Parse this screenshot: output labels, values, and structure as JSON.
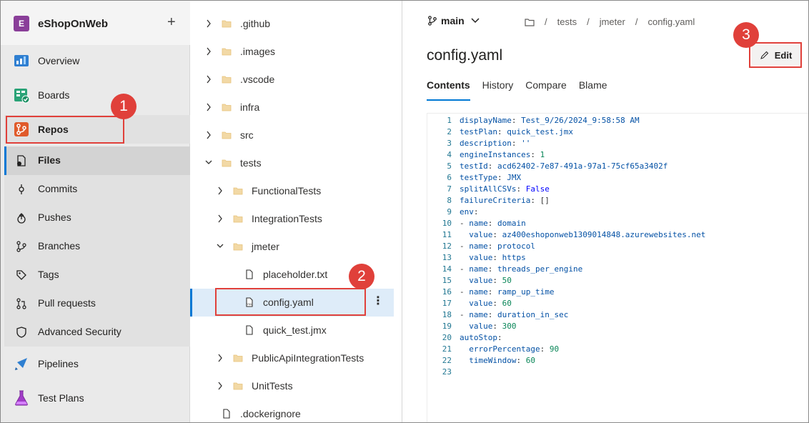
{
  "project": {
    "initial": "E",
    "name": "eShopOnWeb",
    "add_label": "+"
  },
  "nav": {
    "overview": "Overview",
    "boards": "Boards",
    "repos": "Repos",
    "pipelines": "Pipelines",
    "test_plans": "Test Plans"
  },
  "repos_sub": {
    "files": "Files",
    "commits": "Commits",
    "pushes": "Pushes",
    "branches": "Branches",
    "tags": "Tags",
    "pull_requests": "Pull requests",
    "advanced_security": "Advanced Security"
  },
  "tree": {
    "items": [
      {
        "label": ".github"
      },
      {
        "label": ".images"
      },
      {
        "label": ".vscode"
      },
      {
        "label": "infra"
      },
      {
        "label": "src"
      },
      {
        "label": "tests"
      },
      {
        "label": "FunctionalTests"
      },
      {
        "label": "IntegrationTests"
      },
      {
        "label": "jmeter"
      },
      {
        "label": "placeholder.txt"
      },
      {
        "label": "config.yaml"
      },
      {
        "label": "quick_test.jmx"
      },
      {
        "label": "PublicApiIntegrationTests"
      },
      {
        "label": "UnitTests"
      },
      {
        "label": ".dockerignore"
      }
    ],
    "more_label": "⋮"
  },
  "header": {
    "branch": "main",
    "crumbs": [
      "tests",
      "jmeter",
      "config.yaml"
    ],
    "sep": "/",
    "file_title": "config.yaml",
    "edit_label": "Edit"
  },
  "tabs": [
    "Contents",
    "History",
    "Compare",
    "Blame"
  ],
  "code": [
    {
      "n": "1",
      "parts": [
        [
          "k",
          "displayName"
        ],
        [
          "p",
          ": "
        ],
        [
          "s",
          "Test_9/26/2024_9:58:58 AM"
        ]
      ]
    },
    {
      "n": "2",
      "parts": [
        [
          "k",
          "testPlan"
        ],
        [
          "p",
          ": "
        ],
        [
          "s",
          "quick_test.jmx"
        ]
      ]
    },
    {
      "n": "3",
      "parts": [
        [
          "k",
          "description"
        ],
        [
          "p",
          ": "
        ],
        [
          "s",
          "''"
        ]
      ]
    },
    {
      "n": "4",
      "parts": [
        [
          "k",
          "engineInstances"
        ],
        [
          "p",
          ": "
        ],
        [
          "n",
          "1"
        ]
      ]
    },
    {
      "n": "5",
      "parts": [
        [
          "k",
          "testId"
        ],
        [
          "p",
          ": "
        ],
        [
          "s",
          "acd62402-7e87-491a-97a1-75cf65a3402f"
        ]
      ]
    },
    {
      "n": "6",
      "parts": [
        [
          "k",
          "testType"
        ],
        [
          "p",
          ": "
        ],
        [
          "s",
          "JMX"
        ]
      ]
    },
    {
      "n": "7",
      "parts": [
        [
          "k",
          "splitAllCSVs"
        ],
        [
          "p",
          ": "
        ],
        [
          "b",
          "False"
        ]
      ]
    },
    {
      "n": "8",
      "parts": [
        [
          "k",
          "failureCriteria"
        ],
        [
          "p",
          ": []"
        ]
      ]
    },
    {
      "n": "9",
      "parts": [
        [
          "k",
          "env"
        ],
        [
          "p",
          ":"
        ]
      ]
    },
    {
      "n": "10",
      "parts": [
        [
          "p",
          "- "
        ],
        [
          "k",
          "name"
        ],
        [
          "p",
          ": "
        ],
        [
          "s",
          "domain"
        ]
      ]
    },
    {
      "n": "11",
      "parts": [
        [
          "p",
          "  "
        ],
        [
          "k",
          "value"
        ],
        [
          "p",
          ": "
        ],
        [
          "s",
          "az400eshoponweb1309014848.azurewebsites.net"
        ]
      ]
    },
    {
      "n": "12",
      "parts": [
        [
          "p",
          "- "
        ],
        [
          "k",
          "name"
        ],
        [
          "p",
          ": "
        ],
        [
          "s",
          "protocol"
        ]
      ]
    },
    {
      "n": "13",
      "parts": [
        [
          "p",
          "  "
        ],
        [
          "k",
          "value"
        ],
        [
          "p",
          ": "
        ],
        [
          "s",
          "https"
        ]
      ]
    },
    {
      "n": "14",
      "parts": [
        [
          "p",
          "- "
        ],
        [
          "k",
          "name"
        ],
        [
          "p",
          ": "
        ],
        [
          "s",
          "threads_per_engine"
        ]
      ]
    },
    {
      "n": "15",
      "parts": [
        [
          "p",
          "  "
        ],
        [
          "k",
          "value"
        ],
        [
          "p",
          ": "
        ],
        [
          "n",
          "50"
        ]
      ]
    },
    {
      "n": "16",
      "parts": [
        [
          "p",
          "- "
        ],
        [
          "k",
          "name"
        ],
        [
          "p",
          ": "
        ],
        [
          "s",
          "ramp_up_time"
        ]
      ]
    },
    {
      "n": "17",
      "parts": [
        [
          "p",
          "  "
        ],
        [
          "k",
          "value"
        ],
        [
          "p",
          ": "
        ],
        [
          "n",
          "60"
        ]
      ]
    },
    {
      "n": "18",
      "parts": [
        [
          "p",
          "- "
        ],
        [
          "k",
          "name"
        ],
        [
          "p",
          ": "
        ],
        [
          "s",
          "duration_in_sec"
        ]
      ]
    },
    {
      "n": "19",
      "parts": [
        [
          "p",
          "  "
        ],
        [
          "k",
          "value"
        ],
        [
          "p",
          ": "
        ],
        [
          "n",
          "300"
        ]
      ]
    },
    {
      "n": "20",
      "parts": [
        [
          "k",
          "autoStop"
        ],
        [
          "p",
          ":"
        ]
      ]
    },
    {
      "n": "21",
      "parts": [
        [
          "p",
          "  "
        ],
        [
          "k",
          "errorPercentage"
        ],
        [
          "p",
          ": "
        ],
        [
          "n",
          "90"
        ]
      ]
    },
    {
      "n": "22",
      "parts": [
        [
          "p",
          "  "
        ],
        [
          "k",
          "timeWindow"
        ],
        [
          "p",
          ": "
        ],
        [
          "n",
          "60"
        ]
      ]
    },
    {
      "n": "23",
      "parts": []
    }
  ],
  "annotations": {
    "one": "1",
    "two": "2",
    "three": "3"
  },
  "colors": {
    "accent": "#0078d4",
    "annotation": "#e0403a",
    "selected_bg": "#deecf9"
  }
}
